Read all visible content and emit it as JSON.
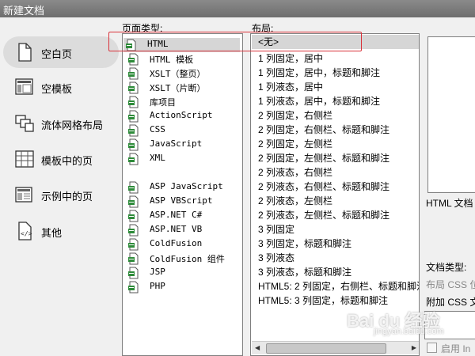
{
  "window": {
    "title": "新建文档"
  },
  "nav": [
    {
      "label": "空白页",
      "icon": "blank-page-icon",
      "selected": true
    },
    {
      "label": "空模板",
      "icon": "template-icon",
      "selected": false
    },
    {
      "label": "流体网格布局",
      "icon": "fluid-grid-icon",
      "selected": false
    },
    {
      "label": "模板中的页",
      "icon": "page-from-template-icon",
      "selected": false
    },
    {
      "label": "示例中的页",
      "icon": "page-from-sample-icon",
      "selected": false
    },
    {
      "label": "其他",
      "icon": "code-icon",
      "selected": false
    }
  ],
  "page_type": {
    "label": "页面类型:",
    "items": [
      "HTML",
      "HTML 模板",
      "XSLT（整页）",
      "XSLT（片断）",
      "库项目",
      "ActionScript",
      "CSS",
      "JavaScript",
      "XML",
      "ASP JavaScript",
      "ASP VBScript",
      "ASP.NET C#",
      "ASP.NET VB",
      "ColdFusion",
      "ColdFusion 组件",
      "JSP",
      "PHP"
    ],
    "selected": "HTML"
  },
  "layout": {
    "label": "布局:",
    "items": [
      "<无>",
      "1 列固定，居中",
      "1 列固定，居中，标题和脚注",
      "1 列液态，居中",
      "1 列液态，居中，标题和脚注",
      "2 列固定，右侧栏",
      "2 列固定，右侧栏、标题和脚注",
      "2 列固定，左侧栏",
      "2 列固定，左侧栏、标题和脚注",
      "2 列液态，右侧栏",
      "2 列液态，右侧栏、标题和脚注",
      "2 列液态，左侧栏",
      "2 列液态，左侧栏、标题和脚注",
      "3 列固定",
      "3 列固定，标题和脚注",
      "3 列液态",
      "3 列液态，标题和脚注",
      "HTML5: 2 列固定，右侧栏、标题和脚注",
      "HTML5: 3 列固定，标题和脚注"
    ],
    "selected": "<无>"
  },
  "right": {
    "doc_label": "HTML 文档",
    "doctype_label": "文档类型:",
    "layout_css_label": "布局 CSS 位",
    "attach_css_label": "附加 CSS 文",
    "enable_label": "启用 In"
  },
  "watermark": {
    "text": "Bai du 经验",
    "sub": "jingyan.baidu.com"
  },
  "colors": {
    "highlight": "#d6d6d6",
    "annotation_red": "#d9323a",
    "titlebar": "#7a7a7a"
  }
}
